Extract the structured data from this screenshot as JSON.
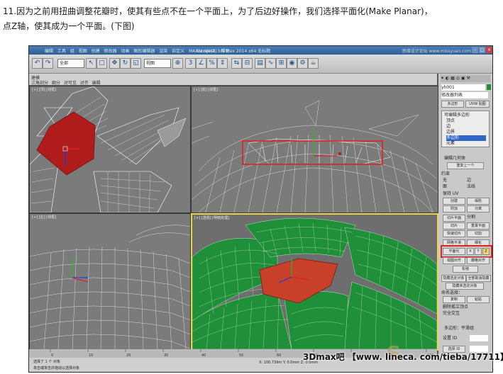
{
  "caption": {
    "line1": "11.因为之前用扭曲调整花瓣时，使其有些点不在一个平面上，为了后边好操作，我们选择平面化(Make Planar)，",
    "line2": "点Z轴，使其成为一个平面。(下图)"
  },
  "app": {
    "menu": "编辑 工具 组 视图 创建 修改器 动画 图形编辑器 渲染 自定义 MAXScript(X) 帮助",
    "window_title": "Autodesk 3ds Max 2014 x64   无标题",
    "window_title_right": "键入关键字或短语",
    "watermark_top": "思缘设计论坛 www.missyuan.com",
    "toolbar_dropdown": "全部",
    "toolbar_view_dropdown": "视图",
    "ribbon_line1": "建模",
    "ribbon_line2": "三角剖分  细分  对可见  对齐  编辑",
    "viewports": {
      "top_left": "[+] [顶] [线框]",
      "top_right": "[+] [前] [线框]",
      "bottom_left": "[+] [左] [线框]",
      "bottom_right": "[+] [透视] [明暗处理]"
    }
  },
  "command_panel": {
    "object_name": "yh001",
    "modifier_list": "修改器列表",
    "btn_poly": "多边形",
    "btn_uvw": "UVW 贴图",
    "stack_title": "可编辑多边形",
    "stack_items": [
      "顶点",
      "边",
      "边界",
      "多边形",
      "元素"
    ],
    "rollout_geometry": "编辑几何体",
    "repeat_last": "重复上一个",
    "constraints": "约束",
    "none": "无",
    "edge": "边",
    "face": "面",
    "normal": "法线",
    "keep_uv": "保持 UV",
    "create": "创建",
    "collapse": "塌陷",
    "attach": "附加",
    "detach": "分离",
    "slice_plane": "切片平面",
    "split": "分割",
    "slice": "切片",
    "reset_plane": "重置平面",
    "quickslice": "快速切片",
    "cut": "切割",
    "meshsmooth": "网格平滑",
    "tessellate": "细化",
    "make_planar": "平面化",
    "axis_x": "X",
    "axis_y": "Y",
    "axis_z": "Z",
    "view_align": "视图对齐",
    "grid_align": "栅格对齐",
    "relax": "松弛",
    "hide_selected": "隐藏选定对象",
    "unhide_all": "全部取消隐藏",
    "hide_unselected": "隐藏未选定对象",
    "named_sel": "命名选择：",
    "copy": "复制",
    "paste": "粘贴",
    "delete_isolated": "删除孤立顶点",
    "full_interactivity": "完全交互",
    "rollout_subdiv": "多边形：平滑组",
    "set_id": "设置 ID",
    "select_id": "选择 ID"
  },
  "timeline_ticks": [
    "0",
    "10",
    "20",
    "30",
    "40",
    "50",
    "60",
    "70",
    "80",
    "90",
    "100"
  ],
  "status": {
    "line1": "选择了 1 个 对象",
    "line2": "单击或单击并拖动以选择对象",
    "coords": "X: 100.739m  Y: 0.0mm  Z: 0.0mm"
  },
  "credit": {
    "site": "3Dmax吧 【www. lineca. com/tieba/17711】",
    "logo": "S"
  },
  "colors": {
    "viewport_bg": "#7b7b7b",
    "petal_green": "#1f8f3a",
    "center_red": "#b01c1c",
    "wire": "#ffffff",
    "highlight": "#dd2222"
  }
}
